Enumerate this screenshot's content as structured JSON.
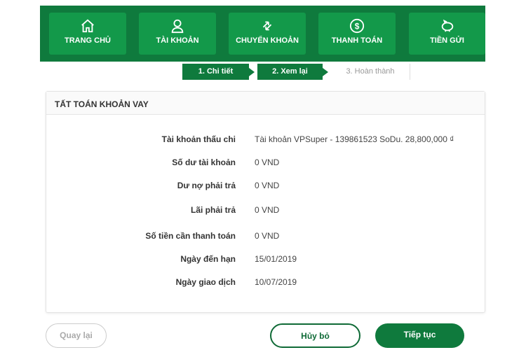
{
  "nav": [
    {
      "label": "TRANG CHỦ",
      "icon": "home-icon"
    },
    {
      "label": "TÀI KHOẢN",
      "icon": "user-icon"
    },
    {
      "label": "CHUYỂN KHOẢN",
      "icon": "transfer-icon"
    },
    {
      "label": "THANH TOÁN",
      "icon": "dollar-icon"
    },
    {
      "label": "TIỀN GỬI",
      "icon": "piggy-bank-icon"
    }
  ],
  "steps": [
    "1. Chi tiết",
    "2. Xem lại",
    "3. Hoàn thành"
  ],
  "card": {
    "title": "TẤT TOÁN KHOẢN VAY",
    "rows": [
      {
        "label": "Tài khoản thấu chi",
        "value": "Tài khoản VPSuper - 139861523 SoDu. 28,800,000 ₫"
      },
      {
        "label": "Số dư tài khoản",
        "value": "0 VND"
      },
      {
        "label": "Dư nợ phải trả",
        "value": "0 VND"
      },
      {
        "label": "Lãi phải trả",
        "value": "0 VND"
      },
      {
        "label": "Số tiền cần thanh toán",
        "value": "0 VND"
      },
      {
        "label": "Ngày đến hạn",
        "value": "15/01/2019"
      },
      {
        "label": "Ngày giao dịch",
        "value": "10/07/2019"
      }
    ]
  },
  "buttons": {
    "back": "Quay lại",
    "cancel": "Hủy bỏ",
    "continue": "Tiếp tục"
  },
  "colors": {
    "brand": "#0f7a3d",
    "tile": "#13994a"
  }
}
